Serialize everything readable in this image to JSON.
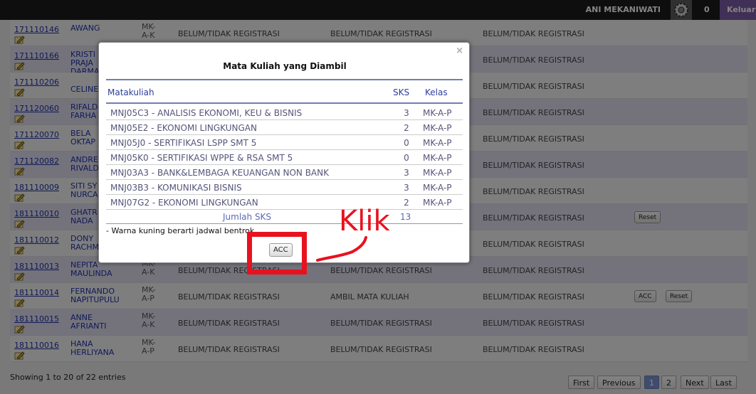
{
  "topbar": {
    "user_name": "ANI MEKANIWATI",
    "notification_count": "0",
    "logout_label": "Keluar",
    "gear_icon": "gear-icon"
  },
  "rows": [
    {
      "nim": "171110146",
      "name_lines": [
        "AWANG",
        ""
      ],
      "kelas": [
        "MK-",
        "A-K"
      ],
      "status1": "BELUM/TIDAK REGISTRASI",
      "status2": "BELUM/TIDAK REGISTRASI",
      "status3": "BELUM/TIDAK REGISTRASI",
      "buttons": []
    },
    {
      "nim": "171110166",
      "name_lines": [
        "KRISTI",
        "PRAJA",
        "DARMA"
      ],
      "kelas": [
        "",
        ""
      ],
      "status1": "",
      "status2": "",
      "status3": "BELUM/TIDAK REGISTRASI",
      "buttons": []
    },
    {
      "nim": "171110206",
      "name_lines": [
        "",
        "CELINE"
      ],
      "kelas": [
        "",
        ""
      ],
      "status1": "",
      "status2": "",
      "status3": "BELUM/TIDAK REGISTRASI",
      "buttons": []
    },
    {
      "nim": "171120060",
      "name_lines": [
        "RIFALD",
        "FARHA"
      ],
      "kelas": [
        "",
        ""
      ],
      "status1": "",
      "status2": "",
      "status3": "BELUM/TIDAK REGISTRASI",
      "buttons": []
    },
    {
      "nim": "171120070",
      "name_lines": [
        "BELA",
        "OKTAP"
      ],
      "kelas": [
        "",
        ""
      ],
      "status1": "",
      "status2": "",
      "status3": "BELUM/TIDAK REGISTRASI",
      "buttons": []
    },
    {
      "nim": "171120082",
      "name_lines": [
        "ANDRE",
        "RIVALD"
      ],
      "kelas": [
        "",
        ""
      ],
      "status1": "",
      "status2": "",
      "status3": "BELUM/TIDAK REGISTRASI",
      "buttons": []
    },
    {
      "nim": "181110009",
      "name_lines": [
        "SITI SY",
        "NURCA"
      ],
      "kelas": [
        "",
        ""
      ],
      "status1": "",
      "status2": "",
      "status3": "BELUM/TIDAK REGISTRASI",
      "buttons": []
    },
    {
      "nim": "181110010",
      "name_lines": [
        "GHATR",
        "NADA"
      ],
      "kelas": [
        "",
        ""
      ],
      "status1": "",
      "status2": "",
      "status3": "BELUM/TIDAK REGISTRASI",
      "buttons": [
        "Reset"
      ]
    },
    {
      "nim": "181110012",
      "name_lines": [
        "DONY",
        "RACHM"
      ],
      "kelas": [
        "",
        ""
      ],
      "status1": "",
      "status2": "",
      "status3": "BELUM/TIDAK REGISTRASI",
      "buttons": []
    },
    {
      "nim": "181110013",
      "name_lines": [
        "NEPITA",
        "MAULINDA"
      ],
      "kelas": [
        "MK-",
        "A-K"
      ],
      "status1": "BELUM/TIDAK REGISTRASI",
      "status2": "BELUM/TIDAK REGISTRASI",
      "status3": "BELUM/TIDAK REGISTRASI",
      "buttons": []
    },
    {
      "nim": "181110014",
      "name_lines": [
        "FERNANDO",
        "NAPITUPULU"
      ],
      "kelas": [
        "MK-",
        "A-P"
      ],
      "status1": "BELUM/TIDAK REGISTRASI",
      "status2": "AMBIL MATA KULIAH",
      "status3": "BELUM/TIDAK REGISTRASI",
      "buttons": [
        "ACC",
        "Reset"
      ]
    },
    {
      "nim": "181110015",
      "name_lines": [
        "ANNE",
        "AFRIANTI"
      ],
      "kelas": [
        "MK-",
        "A-K"
      ],
      "status1": "BELUM/TIDAK REGISTRASI",
      "status2": "BELUM/TIDAK REGISTRASI",
      "status3": "BELUM/TIDAK REGISTRASI",
      "buttons": []
    },
    {
      "nim": "181110016",
      "name_lines": [
        "HANA",
        "HERLIYANA"
      ],
      "kelas": [
        "MK-",
        "A-P"
      ],
      "status1": "BELUM/TIDAK REGISTRASI",
      "status2": "BELUM/TIDAK REGISTRASI",
      "status3": "BELUM/TIDAK REGISTRASI",
      "buttons": []
    }
  ],
  "footer": {
    "showing": "Showing 1 to 20 of 22 entries",
    "pagination": [
      "First",
      "Previous",
      "1",
      "2",
      "Next",
      "Last"
    ],
    "active_page": "1"
  },
  "modal": {
    "title": "Mata Kuliah yang Diambil",
    "close_symbol": "×",
    "headers": {
      "matakuliah": "Matakuliah",
      "sks": "SKS",
      "kelas": "Kelas"
    },
    "courses": [
      {
        "name": "MNJ05C3 - ANALISIS EKONOMI, KEU & BISNIS",
        "sks": "3",
        "kelas": "MK-A-P"
      },
      {
        "name": "MNJ05E2 - EKONOMI LINGKUNGAN",
        "sks": "2",
        "kelas": "MK-A-P"
      },
      {
        "name": "MNJ05J0 - SERTIFIKASI LSPP SMT 5",
        "sks": "0",
        "kelas": "MK-A-P"
      },
      {
        "name": "MNJ05K0 - SERTIFIKASI WPPE & RSA SMT 5",
        "sks": "0",
        "kelas": "MK-A-P"
      },
      {
        "name": "MNJ03A3 - BANK&LEMBAGA KEUANGAN NON BANK",
        "sks": "3",
        "kelas": "MK-A-P"
      },
      {
        "name": "MNJ03B3 - KOMUNIKASI BISNIS",
        "sks": "3",
        "kelas": "MK-A-P"
      },
      {
        "name": "MNJ07G2 - EKONOMI LINGKUNGAN",
        "sks": "2",
        "kelas": "MK-A-P"
      }
    ],
    "total_label": "Jumlah SKS",
    "total_value": "13",
    "note": "- Warna kuning berarti jadwal bentrok",
    "acc_label": "ACC"
  },
  "annotation": {
    "text": "Klik",
    "color": "#e8121f"
  }
}
